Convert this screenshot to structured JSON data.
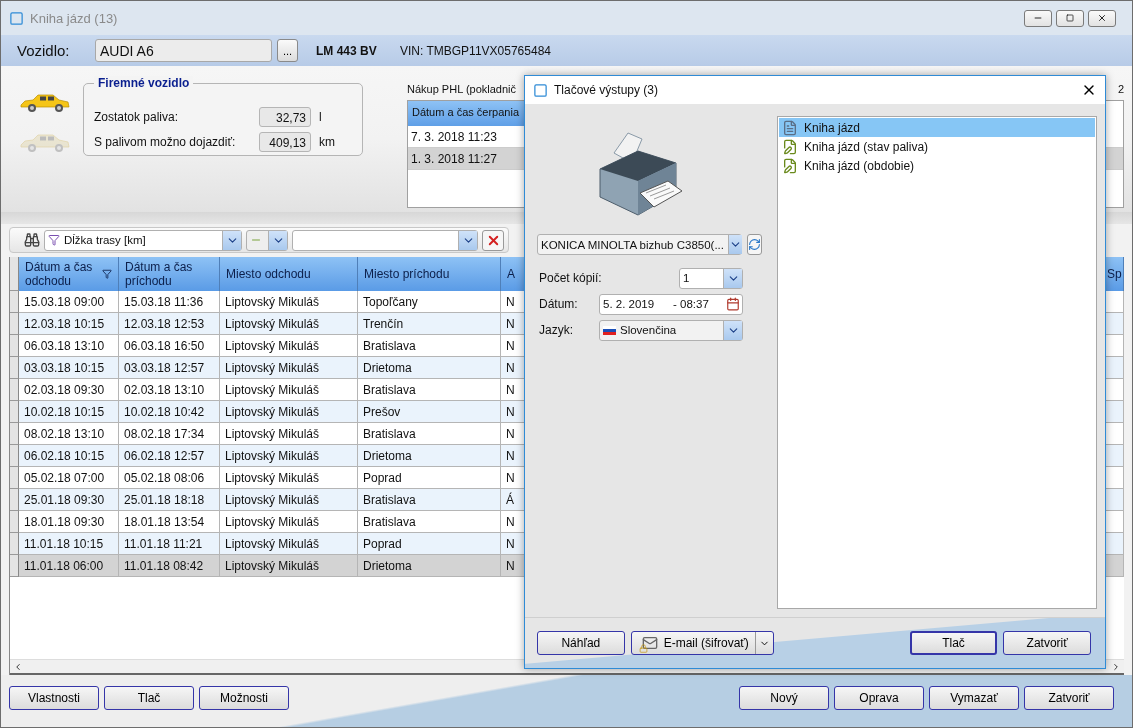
{
  "window": {
    "title": "Kniha jázd (13)"
  },
  "vehicle": {
    "label": "Vozidlo:",
    "value": "AUDI A6",
    "browse_button": "...",
    "plate": "LM 443 BV",
    "vin": "VIN: TMBGP11VX05765484"
  },
  "company_vehicle": {
    "title": "Firemné vozidlo",
    "fields": [
      {
        "label": "Zostatok paliva:",
        "value": "32,73",
        "unit": "l"
      },
      {
        "label": "S palivom možno dojazdiť:",
        "value": "409,13",
        "unit": "km"
      }
    ]
  },
  "fuel_purchases": {
    "title": "Nákup PHL (pokladnič",
    "corner_text": "2",
    "columns": [
      "Dátum a čas čerpania"
    ],
    "rows": [
      {
        "cells": [
          "7. 3. 2018 11:23"
        ],
        "selected": false
      },
      {
        "cells": [
          "1. 3. 2018 11:27"
        ],
        "selected": true
      }
    ]
  },
  "filter": {
    "field": "Dĺžka trasy  [km]"
  },
  "table": {
    "columns": [
      "Dátum a čas odchodu",
      "Dátum a čas príchodu",
      "Miesto odchodu",
      "Miesto príchodu",
      "A",
      "Sp"
    ],
    "rows": [
      {
        "cells": [
          "15.03.18 09:00",
          "15.03.18 11:36",
          "Liptovský Mikuláš",
          "Topoľčany",
          "N"
        ],
        "selected": false
      },
      {
        "cells": [
          "12.03.18 10:15",
          "12.03.18 12:53",
          "Liptovský Mikuláš",
          "Trenčín",
          "N"
        ],
        "selected": false
      },
      {
        "cells": [
          "06.03.18 13:10",
          "06.03.18 16:50",
          "Liptovský Mikuláš",
          "Bratislava",
          "N"
        ],
        "selected": false
      },
      {
        "cells": [
          "03.03.18 10:15",
          "03.03.18 12:57",
          "Liptovský Mikuláš",
          "Drietoma",
          "N"
        ],
        "selected": false
      },
      {
        "cells": [
          "02.03.18 09:30",
          "02.03.18 13:10",
          "Liptovský Mikuláš",
          "Bratislava",
          "N"
        ],
        "selected": false
      },
      {
        "cells": [
          "10.02.18 10:15",
          "10.02.18 10:42",
          "Liptovský Mikuláš",
          "Prešov",
          "N"
        ],
        "selected": false
      },
      {
        "cells": [
          "08.02.18 13:10",
          "08.02.18 17:34",
          "Liptovský Mikuláš",
          "Bratislava",
          "N"
        ],
        "selected": false
      },
      {
        "cells": [
          "06.02.18 10:15",
          "06.02.18 12:57",
          "Liptovský Mikuláš",
          "Drietoma",
          "N"
        ],
        "selected": false
      },
      {
        "cells": [
          "05.02.18 07:00",
          "05.02.18 08:06",
          "Liptovský Mikuláš",
          "Poprad",
          "N"
        ],
        "selected": false
      },
      {
        "cells": [
          "25.01.18 09:30",
          "25.01.18 18:18",
          "Liptovský Mikuláš",
          "Bratislava",
          "Á"
        ],
        "selected": false
      },
      {
        "cells": [
          "18.01.18 09:30",
          "18.01.18 13:54",
          "Liptovský Mikuláš",
          "Bratislava",
          "N"
        ],
        "selected": false
      },
      {
        "cells": [
          "11.01.18 10:15",
          "11.01.18 11:21",
          "Liptovský Mikuláš",
          "Poprad",
          "N"
        ],
        "selected": false
      },
      {
        "cells": [
          "11.01.18 06:00",
          "11.01.18 08:42",
          "Liptovský Mikuláš",
          "Drietoma",
          "N"
        ],
        "selected": true
      }
    ]
  },
  "buttons_left": [
    "Vlastnosti",
    "Tlač",
    "Možnosti"
  ],
  "buttons_right": [
    "Nový",
    "Oprava",
    "Vymazať",
    "Zatvoriť"
  ],
  "dialog": {
    "title": "Tlačové výstupy  (3)",
    "printer": "KONICA MINOLTA bizhub C3850(...",
    "copies": {
      "label": "Počet kópií:",
      "value": "1"
    },
    "date": {
      "label": "Dátum:",
      "date": "5. 2. 2019",
      "time": "- 08:37"
    },
    "language": {
      "label": "Jazyk:",
      "value": "Slovenčina"
    },
    "reports": [
      {
        "label": "Kniha jázd",
        "kind": "document",
        "selected": true
      },
      {
        "label": "Kniha jázd (stav paliva)",
        "kind": "editable",
        "selected": false
      },
      {
        "label": "Kniha jázd (obdobie)",
        "kind": "editable",
        "selected": false
      }
    ],
    "buttons": [
      {
        "label": "Náhľad",
        "kind": "plain"
      },
      {
        "label": "E-mail (šifrovať)",
        "kind": "split"
      },
      {
        "label": "Tlač",
        "kind": "default"
      },
      {
        "label": "Zatvoriť",
        "kind": "plain"
      }
    ]
  }
}
